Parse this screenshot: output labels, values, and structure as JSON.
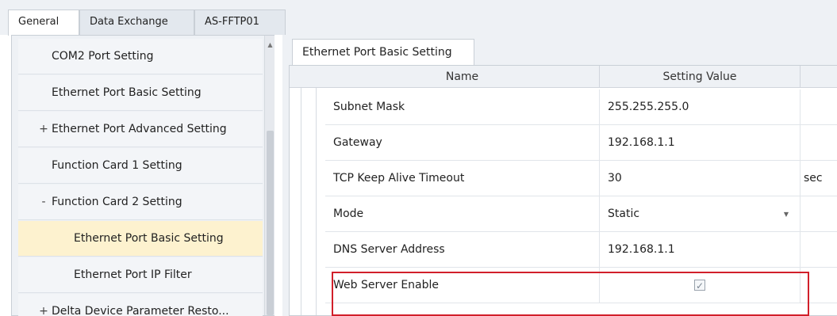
{
  "top_tabs": [
    {
      "label": "General",
      "active": true
    },
    {
      "label": "Data Exchange",
      "active": false
    },
    {
      "label": "AS-FFTP01",
      "active": false
    }
  ],
  "tree": {
    "items": [
      {
        "label": "COM2 Port Setting",
        "expander": ""
      },
      {
        "label": "Ethernet Port Basic Setting",
        "expander": ""
      },
      {
        "label": "Ethernet Port Advanced Setting",
        "expander": "+"
      },
      {
        "label": "Function Card 1 Setting",
        "expander": ""
      },
      {
        "label": "Function Card 2 Setting",
        "expander": "-"
      },
      {
        "label": "Ethernet Port Basic Setting",
        "expander": "",
        "selected": true
      },
      {
        "label": "Ethernet Port IP Filter",
        "expander": ""
      },
      {
        "label": "Delta Device Parameter Resto...",
        "expander": "+"
      }
    ],
    "scroll_up_icon": "up-arrow-icon"
  },
  "content": {
    "tab_label": "Ethernet Port Basic Setting",
    "columns": {
      "name": "Name",
      "value": "Setting Value",
      "unit": ""
    },
    "rows": [
      {
        "name": "Subnet Mask",
        "value": "255.255.255.0",
        "unit": ""
      },
      {
        "name": "Gateway",
        "value": "192.168.1.1",
        "unit": ""
      },
      {
        "name": "TCP Keep Alive Timeout",
        "value": "30",
        "unit": "sec"
      },
      {
        "name": "Mode",
        "value": "Static",
        "unit": "",
        "dropdown": true
      },
      {
        "name": "DNS Server Address",
        "value": "192.168.1.1",
        "unit": ""
      },
      {
        "name": "Web Server Enable",
        "value": "",
        "unit": "",
        "checkbox": true,
        "checked": true
      }
    ]
  },
  "colors": {
    "highlight_border": "#d11f2a",
    "selected_row": "#fdf2cf"
  }
}
